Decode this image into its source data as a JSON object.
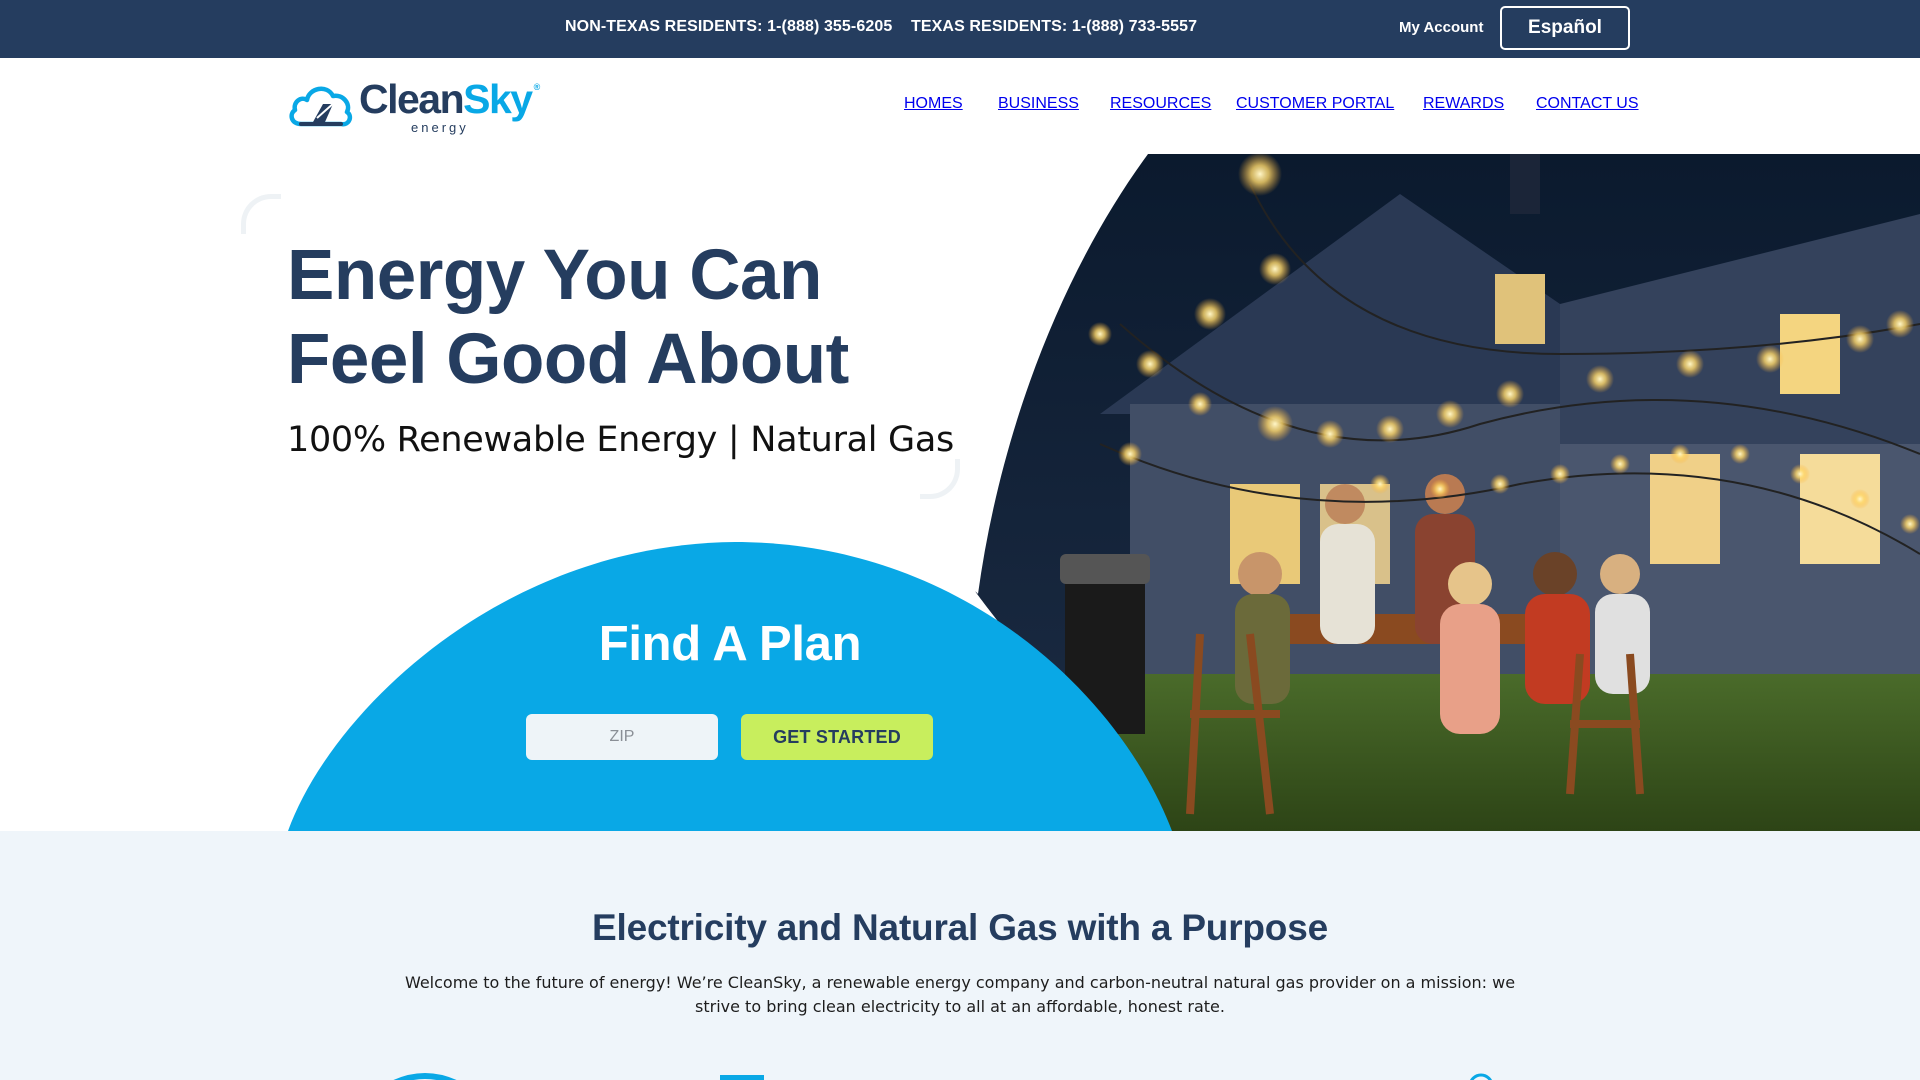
{
  "topbar": {
    "non_texas": "NON-TEXAS RESIDENTS: 1-(888) 355-6205",
    "texas": "TEXAS RESIDENTS: 1-(888) 733-5557",
    "my_account": "My Account",
    "language": "Español"
  },
  "logo": {
    "word_clean": "Clean",
    "word_sky": "Sky",
    "sub": "energy",
    "mark": "®"
  },
  "nav": [
    {
      "label": "HOMES"
    },
    {
      "label": "BUSINESS"
    },
    {
      "label": "RESOURCES"
    },
    {
      "label": "CUSTOMER PORTAL"
    },
    {
      "label": "REWARDS"
    },
    {
      "label": "CONTACT US"
    }
  ],
  "hero": {
    "title_line1": "Energy You Can",
    "title_line2": "Feel Good About",
    "subtitle": "100% Renewable Energy | Natural Gas",
    "photo_description_icon": "family-dinner-backyard-photo"
  },
  "find_plan": {
    "title": "Find A Plan",
    "zip_placeholder": "ZIP",
    "zip_value": "",
    "button": "GET STARTED"
  },
  "purpose": {
    "title": "Electricity and Natural Gas with a Purpose",
    "body": "Welcome to the future of energy! We’re CleanSky, a renewable energy company and carbon-neutral natural gas provider on a mission: we strive to bring clean electricity to all at an affordable, honest rate."
  },
  "colors": {
    "navy": "#253d5f",
    "sky_blue": "#09a8e6",
    "cta_green": "#c8ee5d",
    "section_bg": "#eff5fa"
  }
}
